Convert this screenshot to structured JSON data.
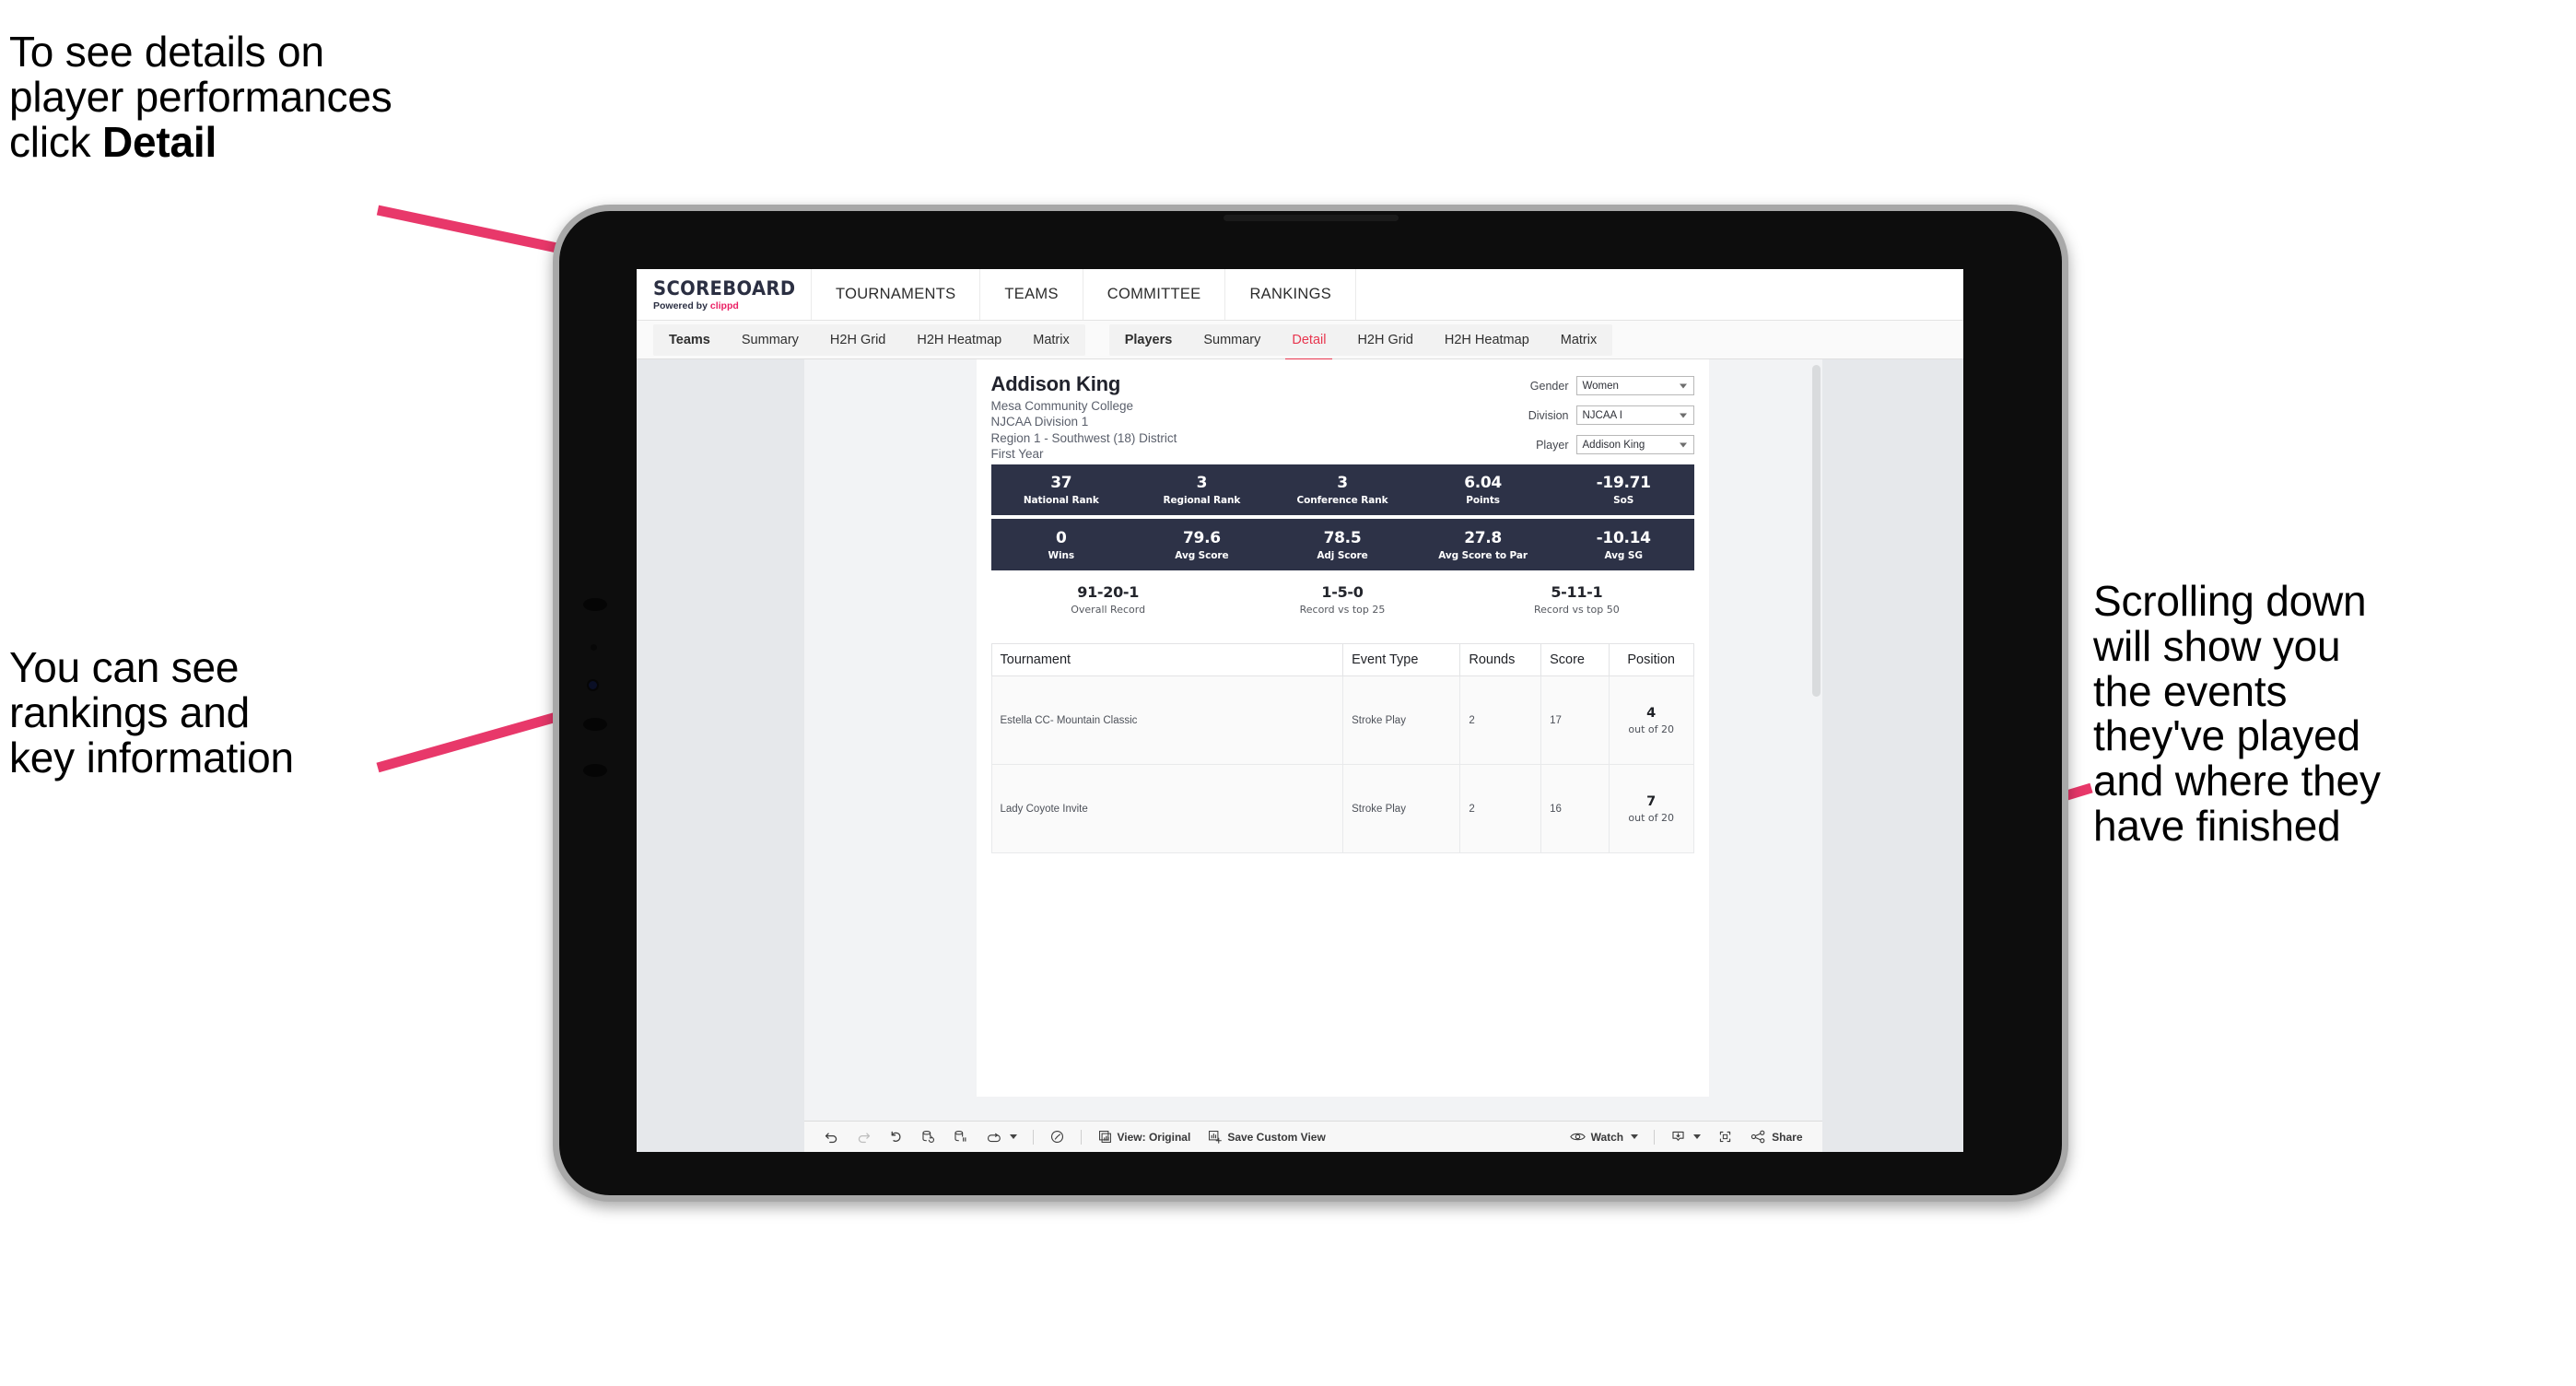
{
  "annotations": {
    "top_left": "To see details on\nplayer performances\nclick ",
    "top_left_bold": "Detail",
    "mid_left": "You can see\nrankings and\nkey information",
    "right": "Scrolling down\nwill show you\nthe events\nthey've played\nand where they\nhave finished"
  },
  "colors": {
    "accent_pink": "#ea1e63",
    "arrow_pink": "#e8386a",
    "stat_navy": "#2d3247",
    "active_tab": "#e8364f"
  },
  "app": {
    "logo": {
      "title": "SCOREBOARD",
      "powered_prefix": "Powered by ",
      "powered_brand": "clippd"
    },
    "top_nav": [
      {
        "label": "TOURNAMENTS"
      },
      {
        "label": "TEAMS"
      },
      {
        "label": "COMMITTEE"
      },
      {
        "label": "RANKINGS"
      }
    ],
    "sub_nav": {
      "group_teams": [
        {
          "label": "Teams",
          "bold": true,
          "active": false
        },
        {
          "label": "Summary",
          "bold": false,
          "active": false
        },
        {
          "label": "H2H Grid",
          "bold": false,
          "active": false
        },
        {
          "label": "H2H Heatmap",
          "bold": false,
          "active": false
        },
        {
          "label": "Matrix",
          "bold": false,
          "active": false
        }
      ],
      "group_players": [
        {
          "label": "Players",
          "bold": true,
          "active": false
        },
        {
          "label": "Summary",
          "bold": false,
          "active": false
        },
        {
          "label": "Detail",
          "bold": false,
          "active": true
        },
        {
          "label": "H2H Grid",
          "bold": false,
          "active": false
        },
        {
          "label": "H2H Heatmap",
          "bold": false,
          "active": false
        },
        {
          "label": "Matrix",
          "bold": false,
          "active": false
        }
      ]
    }
  },
  "player": {
    "name": "Addison King",
    "school": "Mesa Community College",
    "division": "NJCAA Division 1",
    "region": "Region 1 - Southwest (18) District",
    "year": "First Year"
  },
  "filters": [
    {
      "label": "Gender",
      "value": "Women"
    },
    {
      "label": "Division",
      "value": "NJCAA I"
    },
    {
      "label": "Player",
      "value": "Addison King"
    }
  ],
  "stats_row_1": [
    {
      "value": "37",
      "label": "National Rank"
    },
    {
      "value": "3",
      "label": "Regional Rank"
    },
    {
      "value": "3",
      "label": "Conference Rank"
    },
    {
      "value": "6.04",
      "label": "Points"
    },
    {
      "value": "-19.71",
      "label": "SoS"
    }
  ],
  "stats_row_2": [
    {
      "value": "0",
      "label": "Wins"
    },
    {
      "value": "79.6",
      "label": "Avg Score"
    },
    {
      "value": "78.5",
      "label": "Adj Score"
    },
    {
      "value": "27.8",
      "label": "Avg Score to Par"
    },
    {
      "value": "-10.14",
      "label": "Avg SG"
    }
  ],
  "records": [
    {
      "value": "91-20-1",
      "label": "Overall Record"
    },
    {
      "value": "1-5-0",
      "label": "Record vs top 25"
    },
    {
      "value": "5-11-1",
      "label": "Record vs top 50"
    }
  ],
  "events_table": {
    "columns": [
      "Tournament",
      "Event Type",
      "Rounds",
      "Score",
      "Position"
    ],
    "rows": [
      {
        "tournament": "Estella CC- Mountain Classic",
        "event_type": "Stroke Play",
        "rounds": "2",
        "score": "17",
        "position_value": "4",
        "position_out_of": "out of 20"
      },
      {
        "tournament": "Lady Coyote Invite",
        "event_type": "Stroke Play",
        "rounds": "2",
        "score": "16",
        "position_value": "7",
        "position_out_of": "out of 20"
      }
    ]
  },
  "bottom_toolbar": {
    "view_label": "View: Original",
    "save_label": "Save Custom View",
    "watch_label": "Watch",
    "share_label": "Share"
  }
}
